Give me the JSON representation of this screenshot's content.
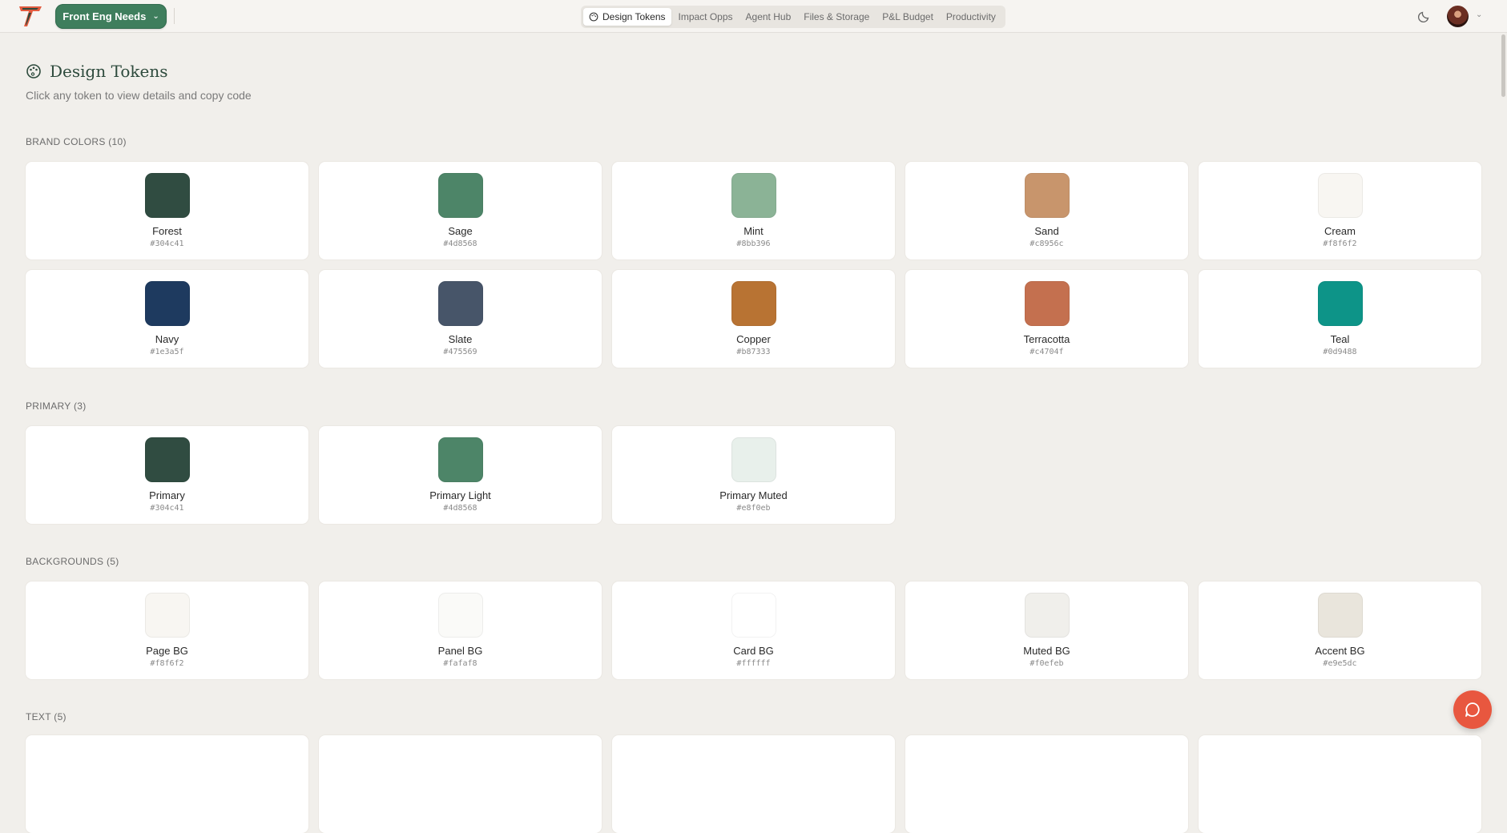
{
  "topbar": {
    "workspace_label": "Front Eng Needs",
    "nav": [
      {
        "label": "Design Tokens",
        "active": true
      },
      {
        "label": "Impact Opps",
        "active": false
      },
      {
        "label": "Agent Hub",
        "active": false
      },
      {
        "label": "Files & Storage",
        "active": false
      },
      {
        "label": "P&L Budget",
        "active": false
      },
      {
        "label": "Productivity",
        "active": false
      }
    ]
  },
  "page": {
    "title": "Design Tokens",
    "subtitle": "Click any token to view details and copy code"
  },
  "sections": [
    {
      "label": "BRAND COLORS (10)",
      "tokens": [
        {
          "name": "Forest",
          "hex": "#304c41"
        },
        {
          "name": "Sage",
          "hex": "#4d8568"
        },
        {
          "name": "Mint",
          "hex": "#8bb396"
        },
        {
          "name": "Sand",
          "hex": "#c8956c"
        },
        {
          "name": "Cream",
          "hex": "#f8f6f2"
        },
        {
          "name": "Navy",
          "hex": "#1e3a5f"
        },
        {
          "name": "Slate",
          "hex": "#475569"
        },
        {
          "name": "Copper",
          "hex": "#b87333"
        },
        {
          "name": "Terracotta",
          "hex": "#c4704f"
        },
        {
          "name": "Teal",
          "hex": "#0d9488"
        }
      ]
    },
    {
      "label": "PRIMARY (3)",
      "tokens": [
        {
          "name": "Primary",
          "hex": "#304c41"
        },
        {
          "name": "Primary Light",
          "hex": "#4d8568"
        },
        {
          "name": "Primary Muted",
          "hex": "#e8f0eb"
        }
      ]
    },
    {
      "label": "BACKGROUNDS (5)",
      "tokens": [
        {
          "name": "Page BG",
          "hex": "#f8f6f2"
        },
        {
          "name": "Panel BG",
          "hex": "#fafaf8"
        },
        {
          "name": "Card BG",
          "hex": "#ffffff"
        },
        {
          "name": "Muted BG",
          "hex": "#f0efeb"
        },
        {
          "name": "Accent BG",
          "hex": "#e9e5dc"
        }
      ]
    },
    {
      "label": "TEXT (5)",
      "tokens": []
    }
  ],
  "colors": {
    "accent": "#3f7e5d",
    "chat_fab": "#e8573f"
  }
}
